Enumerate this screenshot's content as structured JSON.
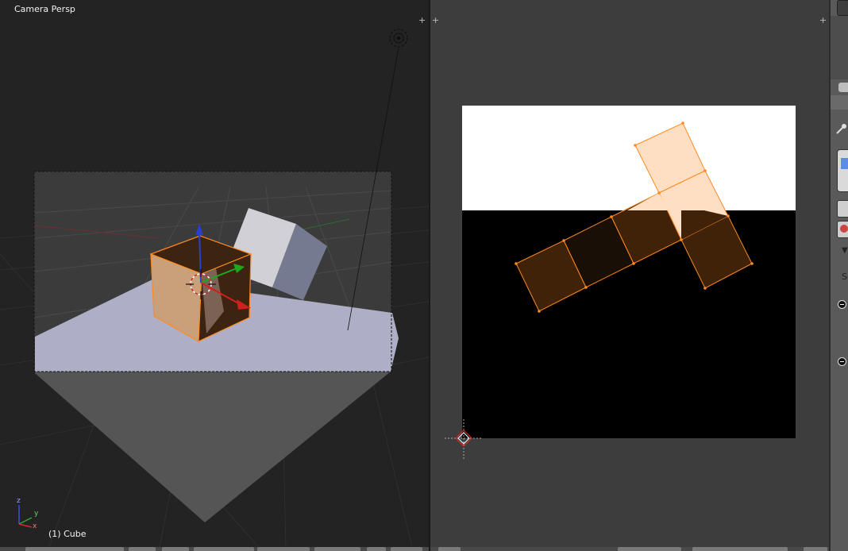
{
  "viewport3d": {
    "view_label": "Camera Persp",
    "object_label": "(1) Cube",
    "corner_plus": "+",
    "axis_z": "z",
    "axis_y": "y",
    "axis_x": "x"
  },
  "uv_editor": {
    "corner_plus": "+"
  },
  "properties": {
    "label_fragment": "Su"
  },
  "colors": {
    "selection_orange": "#ff8a1f",
    "face_dark": "#3f2208",
    "face_light": "#ffdfc4",
    "cube_front": "#caa07a",
    "ground_plane": "#aeaec6",
    "gizmo_z": "#2a3fd0",
    "gizmo_y": "#1ea81e",
    "gizmo_x": "#d41e1e"
  },
  "icons": [
    "corner-plus-icon",
    "lamp-icon",
    "cursor-3d-icon",
    "manipulator-gizmo",
    "axis-widget-icon",
    "pin-icon",
    "expand-triangle-icon",
    "remove-icon"
  ]
}
